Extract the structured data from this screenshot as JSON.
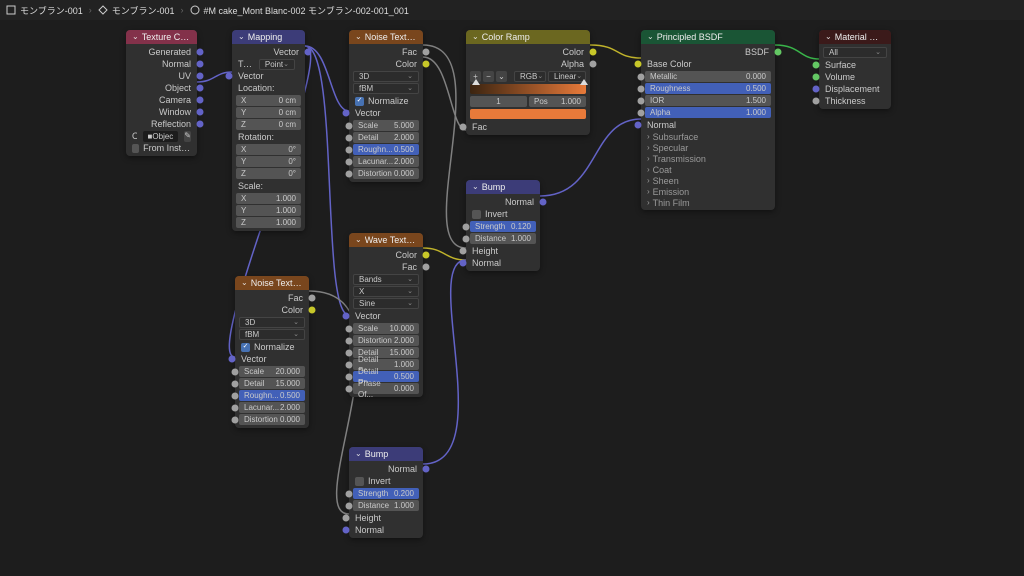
{
  "breadcrumbs": [
    "モンブラン-001",
    "モンブラン-001",
    "#M cake_Mont Blanc-002 モンブラン-002-001_001"
  ],
  "nodes": {
    "texcoord": {
      "title": "Texture Coordinate",
      "outputs": [
        "Generated",
        "Normal",
        "UV",
        "Object",
        "Camera",
        "Window",
        "Reflection"
      ],
      "object_label": "Object:",
      "object_field": "Objec",
      "from_instancer": "From Instancer"
    },
    "mapping": {
      "title": "Mapping",
      "out": "Vector",
      "in": "Vector",
      "type_label": "Type:",
      "type_value": "Point",
      "loc_label": "Location:",
      "loc": [
        [
          "X",
          "0 cm"
        ],
        [
          "Y",
          "0 cm"
        ],
        [
          "Z",
          "0 cm"
        ]
      ],
      "rot_label": "Rotation:",
      "rot": [
        [
          "X",
          "0°"
        ],
        [
          "Y",
          "0°"
        ],
        [
          "Z",
          "0°"
        ]
      ],
      "scale_label": "Scale:",
      "scale": [
        [
          "X",
          "1.000"
        ],
        [
          "Y",
          "1.000"
        ],
        [
          "Z",
          "1.000"
        ]
      ]
    },
    "noise1": {
      "title": "Noise Texture",
      "outs": [
        "Fac",
        "Color"
      ],
      "dim": "3D",
      "interp": "fBM",
      "normalize": "Normalize",
      "vector": "Vector",
      "vals": [
        [
          "Scale",
          "5.000",
          0
        ],
        [
          "Detail",
          "2.000",
          0
        ],
        [
          "Roughn...",
          "0.500",
          1
        ],
        [
          "Lacunar...",
          "2.000",
          0
        ],
        [
          "Distortion",
          "0.000",
          0
        ]
      ]
    },
    "noise2": {
      "title": "Noise Texture",
      "outs": [
        "Fac",
        "Color"
      ],
      "dim": "3D",
      "interp": "fBM",
      "normalize": "Normalize",
      "vector": "Vector",
      "vals": [
        [
          "Scale",
          "20.000",
          0
        ],
        [
          "Detail",
          "15.000",
          0
        ],
        [
          "Roughn...",
          "0.500",
          1
        ],
        [
          "Lacunar...",
          "2.000",
          0
        ],
        [
          "Distortion",
          "0.000",
          0
        ]
      ]
    },
    "wave": {
      "title": "Wave Texture",
      "outs": [
        "Color",
        "Fac"
      ],
      "sel": [
        "Bands",
        "X",
        "Sine"
      ],
      "vector": "Vector",
      "vals": [
        [
          "Scale",
          "10.000",
          0
        ],
        [
          "Distortion",
          "2.000",
          0
        ],
        [
          "Detail",
          "15.000",
          0
        ],
        [
          "Detail Sc...",
          "1.000",
          0
        ],
        [
          "Detail Ro...",
          "0.500",
          1
        ],
        [
          "Phase Of...",
          "0.000",
          0
        ]
      ]
    },
    "ramp": {
      "title": "Color Ramp",
      "outs": [
        "Color",
        "Alpha"
      ],
      "mode": "RGB",
      "interp": "Linear",
      "pos_label": "Pos",
      "pos": "1.000",
      "idx": "1",
      "gradient": [
        "#3b2410",
        "#e87a3a"
      ],
      "swatch": "#e87a3a",
      "in": "Fac"
    },
    "bump1": {
      "title": "Bump",
      "out": "Normal",
      "invert": "Invert",
      "vals": [
        [
          "Strength",
          "0.120",
          1
        ],
        [
          "Distance",
          "1.000",
          0
        ]
      ],
      "ins": [
        "Height",
        "Normal"
      ]
    },
    "bump2": {
      "title": "Bump",
      "out": "Normal",
      "invert": "Invert",
      "vals": [
        [
          "Strength",
          "0.200",
          1
        ],
        [
          "Distance",
          "1.000",
          0
        ]
      ],
      "ins": [
        "Height",
        "Normal"
      ]
    },
    "bsdf": {
      "title": "Principled BSDF",
      "out": "BSDF",
      "base": "Base Color",
      "vals": [
        [
          "Metallic",
          "0.000",
          0
        ],
        [
          "Roughness",
          "0.500",
          1
        ],
        [
          "IOR",
          "1.500",
          0
        ],
        [
          "Alpha",
          "1.000",
          1
        ]
      ],
      "normal": "Normal",
      "exp": [
        "Subsurface",
        "Specular",
        "Transmission",
        "Coat",
        "Sheen",
        "Emission",
        "Thin Film"
      ]
    },
    "matout": {
      "title": "Material Output",
      "target": "All",
      "ins": [
        "Surface",
        "Volume",
        "Displacement",
        "Thickness"
      ]
    }
  }
}
